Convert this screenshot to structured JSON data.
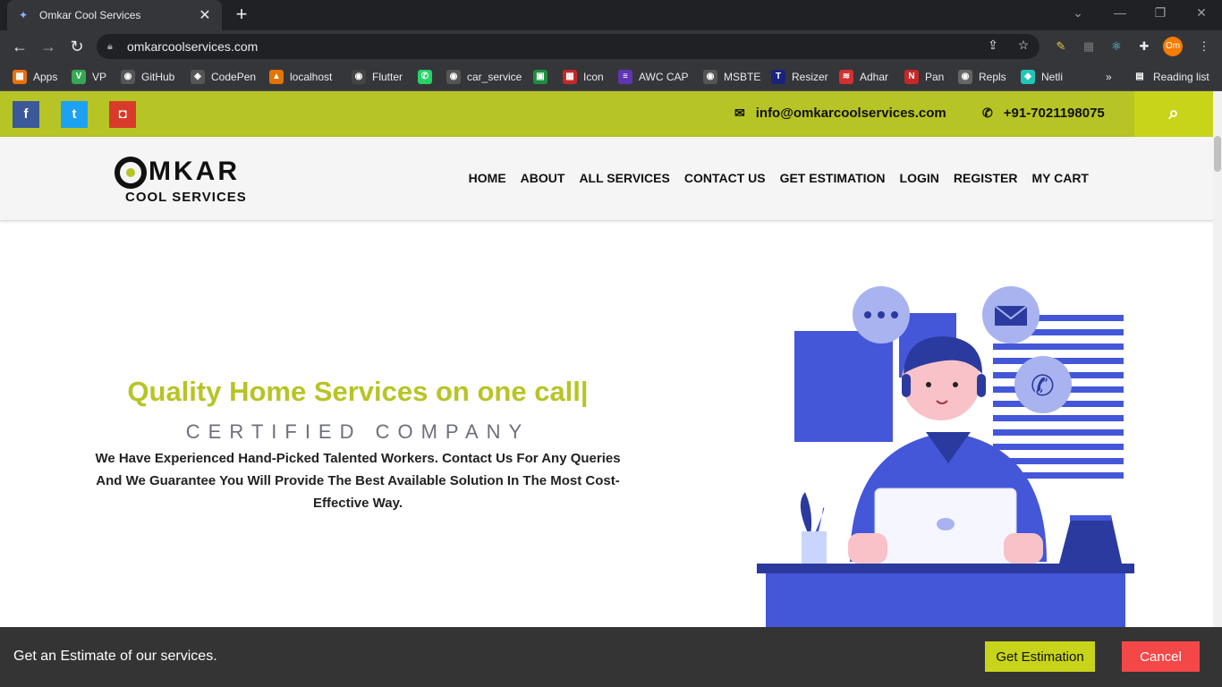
{
  "browser": {
    "tab_title": "Omkar Cool Services",
    "url": "omkarcoolservices.com",
    "bookmarks": [
      {
        "label": "Apps",
        "icon": "apps-grid-icon",
        "color": "#e8710a"
      },
      {
        "label": "VP",
        "icon": "vp-icon",
        "color": "#34a853"
      },
      {
        "label": "GitHub",
        "icon": "github-icon",
        "color": "#555"
      },
      {
        "label": "CodePen",
        "icon": "codepen-icon",
        "color": "#555"
      },
      {
        "label": "localhost",
        "icon": "localhost-icon",
        "color": "#e37400"
      },
      {
        "label": "Flutter",
        "icon": "flutter-icon",
        "color": "#444"
      },
      {
        "label": "",
        "icon": "whatsapp-icon",
        "color": "#25d366"
      },
      {
        "label": "car_service",
        "icon": "github-icon",
        "color": "#555"
      },
      {
        "label": "",
        "icon": "green-app-icon",
        "color": "#1e8e3e"
      },
      {
        "label": "Icon",
        "icon": "icon-grid-icon",
        "color": "#c62828"
      },
      {
        "label": "AWC CAP",
        "icon": "awc-icon",
        "color": "#5e35b1"
      },
      {
        "label": "MSBTE",
        "icon": "msbte-icon",
        "color": "#555"
      },
      {
        "label": "Resizer",
        "icon": "resizer-icon",
        "color": "#1a237e"
      },
      {
        "label": "Adhar",
        "icon": "adhar-icon",
        "color": "#d32f2f"
      },
      {
        "label": "Pan",
        "icon": "pan-icon",
        "color": "#c62828"
      },
      {
        "label": "Repls",
        "icon": "repls-icon",
        "color": "#666"
      },
      {
        "label": "Netli",
        "icon": "netlify-icon",
        "color": "#20c6b7"
      }
    ],
    "reading_list": "Reading list",
    "more_bookmarks": "»"
  },
  "topbar": {
    "email": "info@omkarcoolservices.com",
    "phone": "+91-7021198075",
    "social": [
      {
        "name": "facebook",
        "glyph": "f",
        "color": "#3b5998"
      },
      {
        "name": "twitter",
        "glyph": "t",
        "color": "#1da1f2"
      },
      {
        "name": "instagram",
        "glyph": "◘",
        "color": "#d93b2b"
      }
    ]
  },
  "logo": {
    "line1": "MKAR",
    "line2": "COOL SERVICES"
  },
  "nav": [
    "HOME",
    "ABOUT",
    "ALL SERVICES",
    "CONTACT US",
    "GET ESTIMATION",
    "LOGIN",
    "REGISTER",
    "MY CART"
  ],
  "hero": {
    "title": "Quality Home Services on one call|",
    "subtitle": "CERTIFIED COMPANY",
    "description": "We Have Experienced Hand-Picked Talented Workers. Contact Us For Any Queries And We Guarantee You Will Provide The Best Available Solution In The Most Cost-Effective Way."
  },
  "estimate_bar": {
    "text": "Get an Estimate of our services.",
    "estimate_button": "Get Estimation",
    "cancel_button": "Cancel"
  },
  "colors": {
    "brand": "#b7c425",
    "accent": "#c8d41a",
    "cancel": "#f44848",
    "illustration_blue": "#4457d9"
  }
}
